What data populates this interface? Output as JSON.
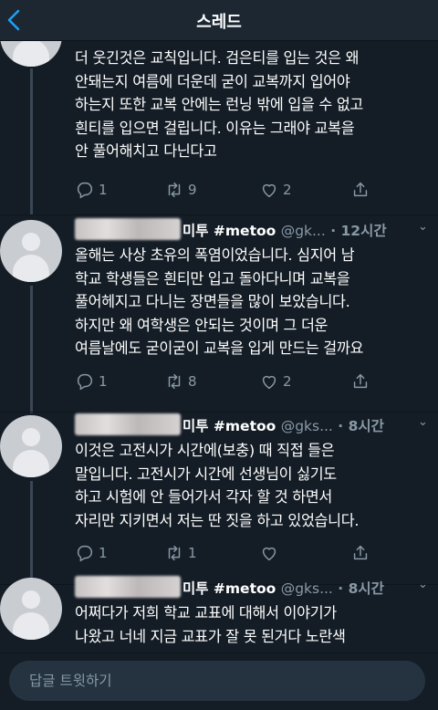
{
  "header": {
    "title": "스레드",
    "back_label": "back"
  },
  "tweets": [
    {
      "display_name": "",
      "handle": "",
      "time": "",
      "text": "더 웃긴것은 교칙입니다. 검은티를 입는 것은 왜\n안돼는지 여름에 더운데 굳이 교복까지 입어야\n하는지 또한 교복 안에는 런닝 밖에 입을 수 없고\n흰티를 입으면 걸립니다. 이유는 그래야 교복을\n안 풀어해치고 다닌다고",
      "replies": "1",
      "retweets": "9",
      "likes": "2"
    },
    {
      "display_name": "미투 #metoo",
      "handle": "@gk...",
      "time": "12시간",
      "text": "올해는 사상 초유의 폭염이었습니다. 심지어 남\n학교 학생들은 흰티만 입고 돌아다니며 교복을\n풀어헤지고 다니는 장면들을 많이 보았습니다.\n하지만 왜 여학생은 안되는 것이며 그 더운\n여름날에도 굳이굳이 교복을 입게 만드는 걸까요",
      "replies": "1",
      "retweets": "8",
      "likes": "2"
    },
    {
      "display_name": "미투 #metoo",
      "handle": "@gks...",
      "time": "8시간",
      "text": "이것은 고전시가 시간에(보충) 때 직접 들은\n말입니다. 고전시가 시간에 선생님이 싫기도\n하고 시험에 안 들어가서 각자 할 것 하면서\n자리만 지키면서 저는 딴 짓을 하고 있었습니다.",
      "replies": "1",
      "retweets": "1",
      "likes": ""
    },
    {
      "display_name": "미투 #metoo",
      "handle": "@gks...",
      "time": "8시간",
      "text": "어쩌다가 저희 학교 교표에 대해서 이야기가\n나왔고 너네 지금 교표가 잘 못 된거다 노란색",
      "replies": "",
      "retweets": "",
      "likes": ""
    }
  ],
  "reply_bar": {
    "placeholder": "답글 트윗하기"
  },
  "colors": {
    "background": "#141d26",
    "accent": "#1da1f2",
    "muted": "#8899a6",
    "input": "#253341"
  },
  "icons": [
    "back-chevron-icon",
    "reply-icon",
    "retweet-icon",
    "like-icon",
    "share-icon",
    "dropdown-chevron-icon"
  ]
}
